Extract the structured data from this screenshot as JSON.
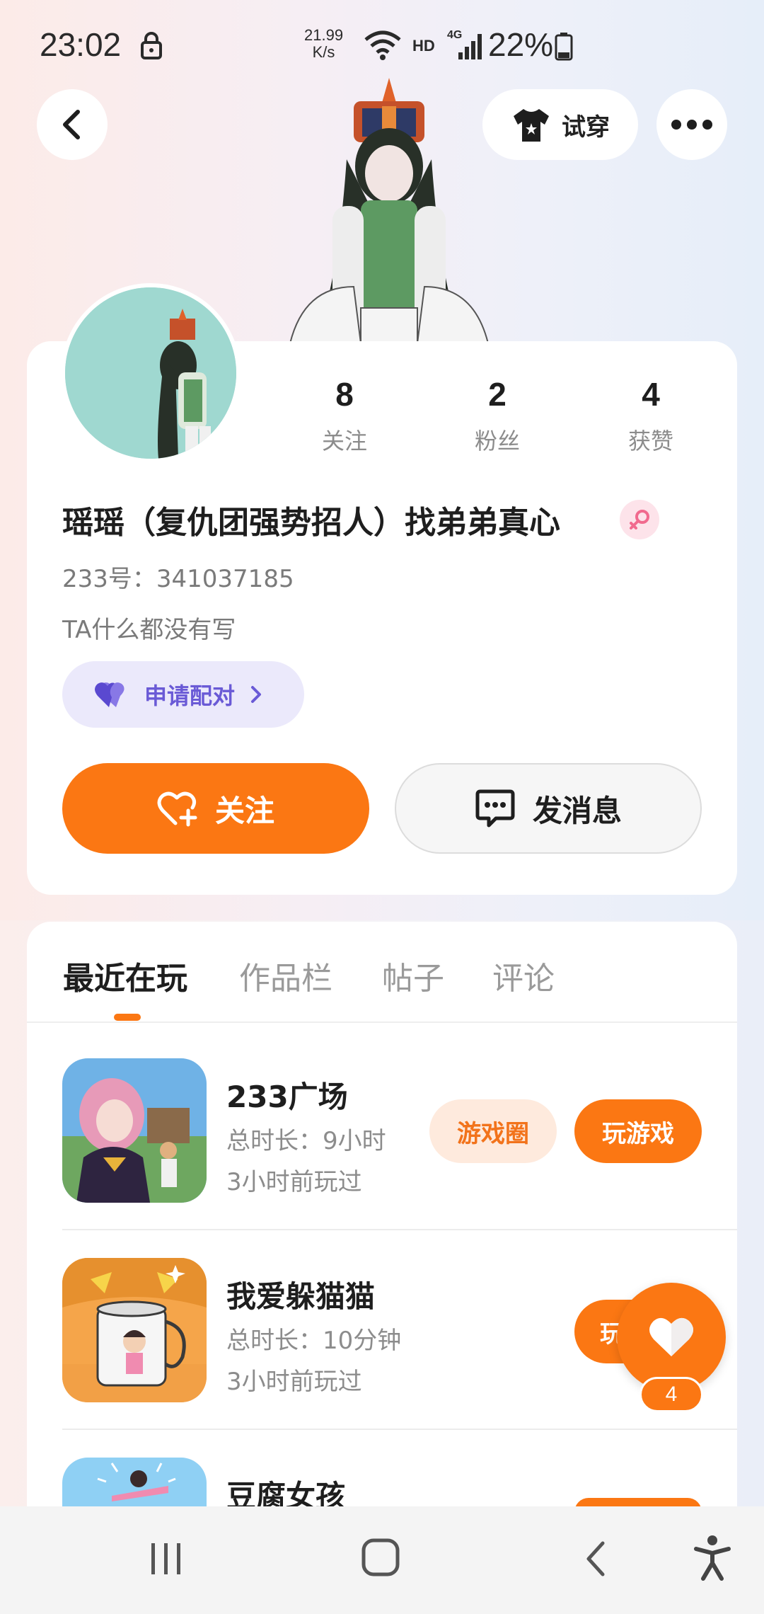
{
  "status_bar": {
    "time": "23:02",
    "net_speed_value": "21.99",
    "net_speed_unit": "K/s",
    "hd": "HD",
    "network": "4G",
    "battery": "22%"
  },
  "header": {
    "try_on_label": "试穿"
  },
  "profile": {
    "stats": [
      {
        "value": "8",
        "label": "关注"
      },
      {
        "value": "2",
        "label": "粉丝"
      },
      {
        "value": "4",
        "label": "获赞"
      }
    ],
    "name": "瑶瑶（复仇团强势招人）找弟弟真心",
    "uid": "233号：341037185",
    "bio": "TA什么都没有写",
    "pair_label": "申请配对",
    "follow_label": "关注",
    "message_label": "发消息"
  },
  "tabs": [
    {
      "label": "最近在玩",
      "active": true
    },
    {
      "label": "作品栏",
      "active": false
    },
    {
      "label": "帖子",
      "active": false
    },
    {
      "label": "评论",
      "active": false
    }
  ],
  "games": [
    {
      "title": "233广场",
      "duration": "总时长：9小时",
      "last_played": "3小时前玩过",
      "circle_label": "游戏圈",
      "play_label": "玩游戏"
    },
    {
      "title": "我爱躲猫猫",
      "duration": "总时长：10分钟",
      "last_played": "3小时前玩过",
      "play_label_partial": "玩"
    },
    {
      "title": "豆腐女孩"
    }
  ],
  "floating_like": {
    "count": "4"
  },
  "colors": {
    "accent": "#fb7713",
    "pair": "#6a5ad6"
  }
}
